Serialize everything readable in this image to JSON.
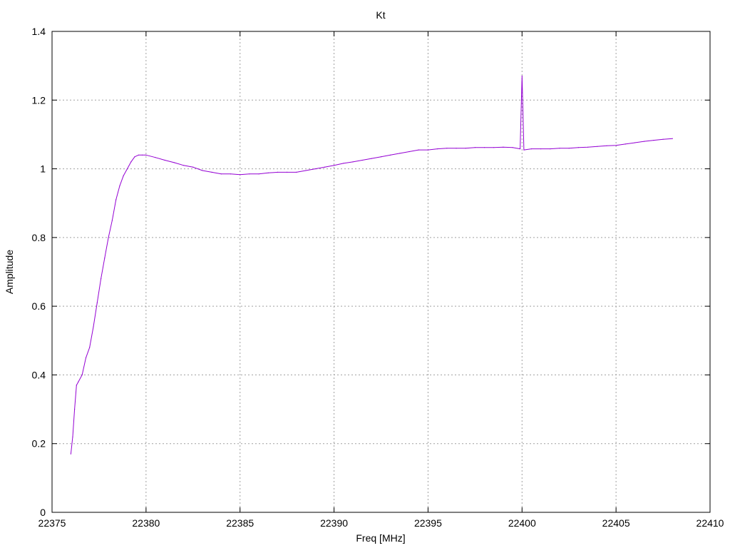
{
  "chart_data": {
    "type": "line",
    "title": "Kt",
    "xlabel": "Freq [MHz]",
    "ylabel": "Amplitude",
    "xlim": [
      22375,
      22410
    ],
    "ylim": [
      0,
      1.4
    ],
    "xticks": [
      "22375",
      "22380",
      "22385",
      "22390",
      "22395",
      "22400",
      "22405",
      "22410"
    ],
    "yticks": [
      "0",
      "0.2",
      "0.4",
      "0.6",
      "0.8",
      "1",
      "1.2",
      "1.4"
    ],
    "grid": true,
    "legend": "none",
    "series": [
      {
        "color": "#9400d3",
        "x": [
          22376.0,
          22376.1,
          22376.2,
          22376.3,
          22376.4,
          22376.6,
          22376.8,
          22377.0,
          22377.2,
          22377.4,
          22377.6,
          22377.8,
          22378.0,
          22378.2,
          22378.4,
          22378.6,
          22378.8,
          22379.0,
          22379.2,
          22379.4,
          22379.6,
          22379.8,
          22380.0,
          22380.5,
          22381.0,
          22381.5,
          22382.0,
          22382.5,
          22383.0,
          22383.5,
          22384.0,
          22384.5,
          22385.0,
          22385.5,
          22386.0,
          22386.5,
          22387.0,
          22387.5,
          22388.0,
          22388.5,
          22389.0,
          22389.5,
          22390.0,
          22390.5,
          22391.0,
          22391.5,
          22392.0,
          22392.5,
          22393.0,
          22393.5,
          22394.0,
          22394.5,
          22395.0,
          22395.5,
          22396.0,
          22396.5,
          22397.0,
          22397.5,
          22398.0,
          22398.5,
          22399.0,
          22399.5,
          22399.9,
          22400.0,
          22400.1,
          22400.5,
          22401.0,
          22401.5,
          22402.0,
          22402.5,
          22403.0,
          22403.5,
          22404.0,
          22404.5,
          22405.0,
          22405.5,
          22406.0,
          22406.5,
          22407.0,
          22407.5,
          22408.0
        ],
        "y": [
          0.17,
          0.22,
          0.3,
          0.37,
          0.38,
          0.4,
          0.45,
          0.48,
          0.54,
          0.61,
          0.68,
          0.74,
          0.8,
          0.85,
          0.91,
          0.95,
          0.98,
          1.0,
          1.02,
          1.035,
          1.04,
          1.04,
          1.04,
          1.033,
          1.025,
          1.018,
          1.01,
          1.005,
          0.995,
          0.99,
          0.985,
          0.985,
          0.983,
          0.985,
          0.985,
          0.988,
          0.99,
          0.99,
          0.99,
          0.995,
          1.0,
          1.005,
          1.01,
          1.016,
          1.02,
          1.025,
          1.03,
          1.035,
          1.04,
          1.045,
          1.05,
          1.055,
          1.055,
          1.058,
          1.06,
          1.06,
          1.06,
          1.062,
          1.062,
          1.062,
          1.063,
          1.062,
          1.058,
          1.27,
          1.055,
          1.058,
          1.058,
          1.058,
          1.06,
          1.06,
          1.062,
          1.063,
          1.065,
          1.067,
          1.068,
          1.072,
          1.076,
          1.08,
          1.083,
          1.086,
          1.088
        ]
      }
    ]
  }
}
